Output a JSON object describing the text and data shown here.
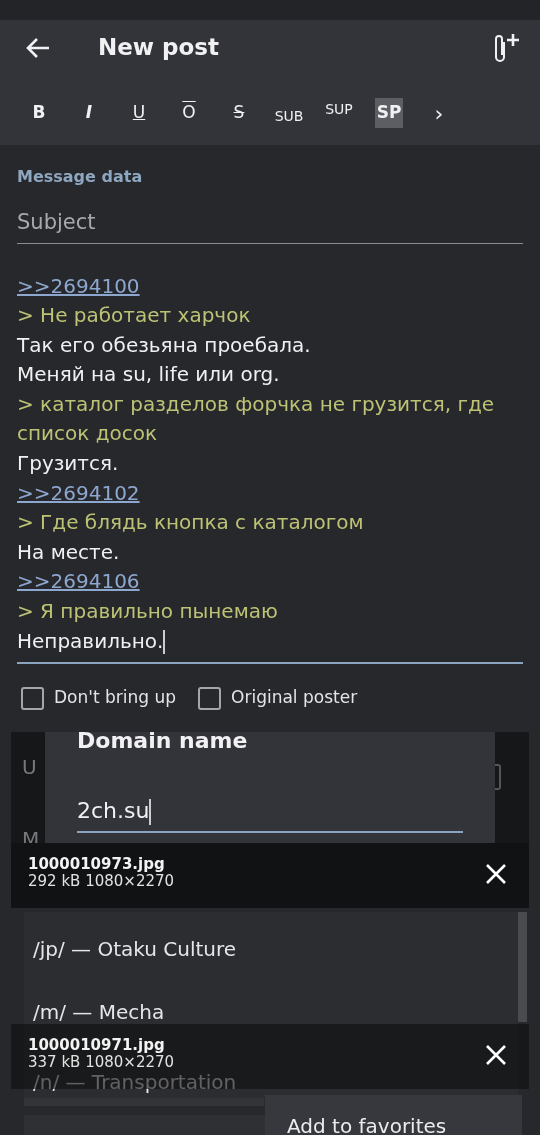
{
  "app_bar": {
    "title": "New post"
  },
  "format_buttons": [
    {
      "label": "B",
      "kind": "bold"
    },
    {
      "label": "I",
      "kind": "italic"
    },
    {
      "label": "U",
      "kind": "underline"
    },
    {
      "label": "O",
      "kind": "overline"
    },
    {
      "label": "S",
      "kind": "strike"
    },
    {
      "label": "SUB",
      "kind": "sub"
    },
    {
      "label": "SUP",
      "kind": "sup"
    },
    {
      "label": "SP",
      "kind": "spoiler"
    },
    {
      "label": "›",
      "kind": "more"
    }
  ],
  "section_label": "Message data",
  "subject": {
    "placeholder": "Subject"
  },
  "message_lines": [
    {
      "kind": "link",
      "text": ">>2694100"
    },
    {
      "kind": "quote",
      "text": "> Не работает харчок"
    },
    {
      "kind": "text",
      "text": "Так его обезьяна проебала."
    },
    {
      "kind": "text",
      "text": "Меняй на su, life или org."
    },
    {
      "kind": "quote",
      "text": "> каталог разделов форчка не грузится, где список досок"
    },
    {
      "kind": "text",
      "text": "Грузится."
    },
    {
      "kind": "link",
      "text": ">>2694102"
    },
    {
      "kind": "quote",
      "text": "> Где блядь кнопка с каталогом"
    },
    {
      "kind": "text",
      "text": "На месте."
    },
    {
      "kind": "link",
      "text": ">>2694106"
    },
    {
      "kind": "quote",
      "text": "> Я правильно пынемаю"
    },
    {
      "kind": "text",
      "text": "Неправильно."
    }
  ],
  "checkboxes": [
    {
      "label": "Don't bring up",
      "checked": false
    },
    {
      "label": "Original poster",
      "checked": false
    }
  ],
  "background_fragments": [
    "U",
    "M"
  ],
  "domain_dialog": {
    "title": "Domain name",
    "value": "2ch.su"
  },
  "attachments": [
    {
      "name": "1000010973.jpg",
      "info": "292 kB 1080×2270"
    },
    {
      "name": "1000010971.jpg",
      "info": "337 kB 1080×2270"
    }
  ],
  "boards": [
    "/jp/ — Otaku Culture",
    "/m/ — Mecha",
    "/n/ — Transportation"
  ],
  "context_menu": [
    "Add to favorites"
  ]
}
